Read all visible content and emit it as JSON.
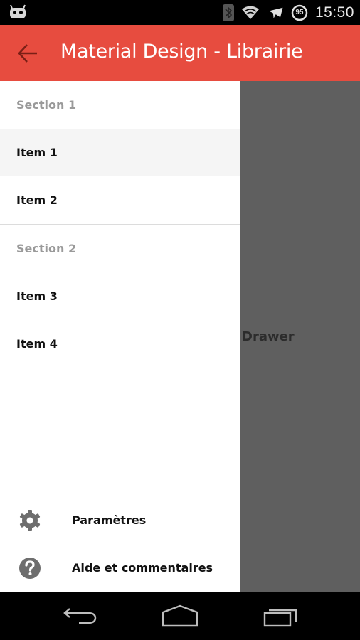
{
  "status_bar": {
    "battery_level": "95",
    "time": "15:50",
    "icons": [
      "cyanogen-logo-icon",
      "bluetooth-icon",
      "wifi-icon",
      "airplane-icon",
      "battery-icon"
    ]
  },
  "app_bar": {
    "back_icon": "arrow-back-icon",
    "title": "Material Design - Librairie",
    "color": "#e74c3f"
  },
  "drawer": {
    "sections": [
      {
        "header": "Section 1",
        "items": [
          {
            "label": "Item 1",
            "selected": true
          },
          {
            "label": "Item 2",
            "selected": false
          }
        ]
      },
      {
        "header": "Section 2",
        "items": [
          {
            "label": "Item 3",
            "selected": false
          },
          {
            "label": "Item 4",
            "selected": false
          }
        ]
      }
    ],
    "footer_actions": [
      {
        "icon": "gear-icon",
        "label": "Paramètres"
      },
      {
        "icon": "help-icon",
        "label": "Aide et commentaires"
      }
    ]
  },
  "main": {
    "text": "Drawer"
  },
  "nav_bar": {
    "buttons": [
      "back-nav-icon",
      "home-nav-icon",
      "recents-nav-icon"
    ]
  }
}
